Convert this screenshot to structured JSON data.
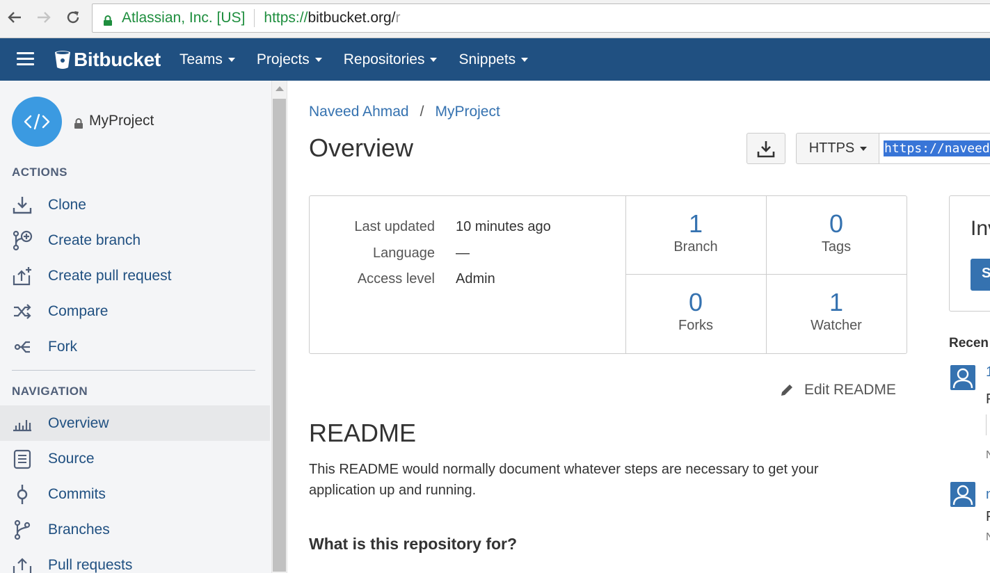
{
  "browser": {
    "secure_label": "Atlassian, Inc. [US]",
    "url_scheme": "https://",
    "url_host": "bitbucket.org/",
    "url_rest": "r"
  },
  "header": {
    "logo_text": "Bitbucket",
    "menu": [
      {
        "label": "Teams"
      },
      {
        "label": "Projects"
      },
      {
        "label": "Repositories"
      },
      {
        "label": "Snippets"
      }
    ]
  },
  "sidebar": {
    "project_name": "MyProject",
    "actions_title": "ACTIONS",
    "actions": [
      {
        "label": "Clone",
        "icon": "download-icon"
      },
      {
        "label": "Create branch",
        "icon": "branch-plus-icon"
      },
      {
        "label": "Create pull request",
        "icon": "upload-plus-icon"
      },
      {
        "label": "Compare",
        "icon": "shuffle-icon"
      },
      {
        "label": "Fork",
        "icon": "fork-icon"
      }
    ],
    "navigation_title": "NAVIGATION",
    "navigation": [
      {
        "label": "Overview",
        "icon": "bar-chart-icon",
        "active": true
      },
      {
        "label": "Source",
        "icon": "document-icon"
      },
      {
        "label": "Commits",
        "icon": "commit-icon"
      },
      {
        "label": "Branches",
        "icon": "branches-icon"
      },
      {
        "label": "Pull requests",
        "icon": "pull-request-icon"
      }
    ]
  },
  "main": {
    "breadcrumb": [
      "Naveed Ahmad",
      "MyProject"
    ],
    "breadcrumb_sep": "/",
    "title": "Overview",
    "protocol": "HTTPS",
    "clone_url": "https://naveedah",
    "meta": [
      {
        "label": "Last updated",
        "value": "10 minutes ago"
      },
      {
        "label": "Language",
        "value": "—"
      },
      {
        "label": "Access level",
        "value": "Admin"
      }
    ],
    "stats": [
      {
        "value": "1",
        "label": "Branch"
      },
      {
        "value": "0",
        "label": "Tags"
      },
      {
        "value": "0",
        "label": "Forks"
      },
      {
        "value": "1",
        "label": "Watcher"
      }
    ],
    "edit_readme": "Edit README",
    "readme_title": "README",
    "readme_text": "This README would normally document whatever steps are necessary to get your application up and running.",
    "readme_subtitle": "What is this repository for?",
    "invite_title": "Inv",
    "invite_button": "S",
    "recent_title": "Recen",
    "recent_fragments": [
      "1",
      "F",
      "N",
      "n",
      "F",
      "N"
    ]
  },
  "colors": {
    "header_bg": "#205081",
    "link": "#3572b0",
    "avatar": "#3b9ae1",
    "secure_green": "#1e8e3e"
  }
}
